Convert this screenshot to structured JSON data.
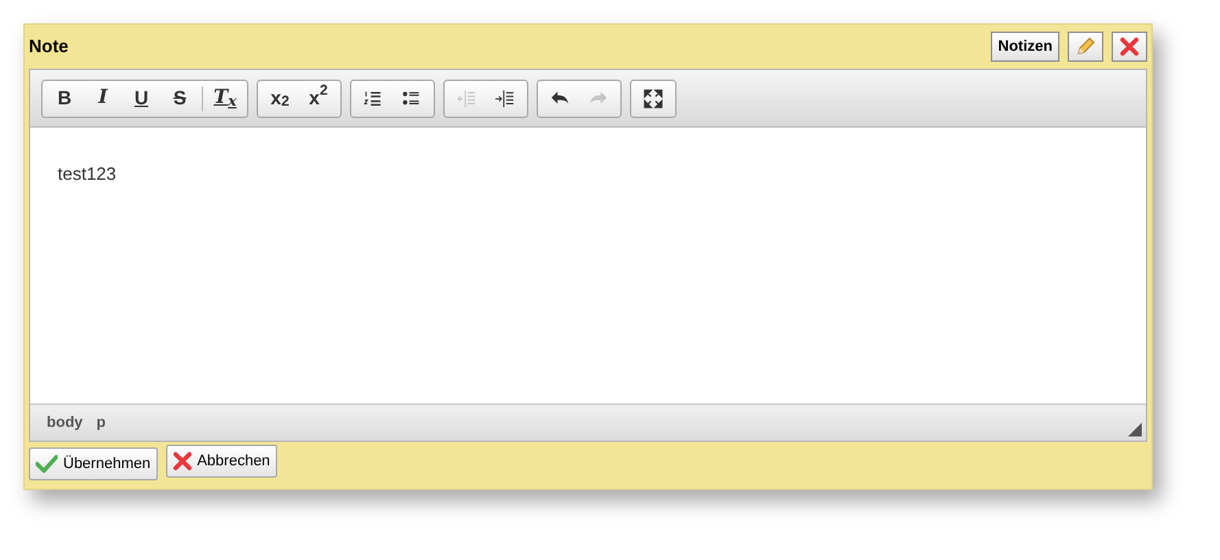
{
  "panel": {
    "title": "Note",
    "header_buttons": [
      {
        "kind": "text",
        "label": "Notizen"
      },
      {
        "kind": "edit"
      },
      {
        "kind": "close"
      }
    ]
  },
  "toolbar": {
    "groups": [
      {
        "items": [
          {
            "kind": "bold",
            "label": "B",
            "disabled": false
          },
          {
            "kind": "italic",
            "label": "I",
            "disabled": false
          },
          {
            "kind": "underline",
            "label": "U",
            "disabled": false
          },
          {
            "kind": "strike",
            "label": "S",
            "disabled": false
          },
          {
            "kind": "clear",
            "label": "T$_{x}$",
            "disabled": false
          }
        ]
      },
      {
        "items": [
          {
            "kind": "sub",
            "label": "x$_{2}$",
            "disabled": false
          },
          {
            "kind": "sup",
            "label": "x$^{2}$",
            "disabled": false
          }
        ]
      },
      {
        "items": [
          {
            "kind": "ol",
            "disabled": false
          },
          {
            "kind": "ul",
            "disabled": false
          }
        ]
      },
      {
        "items": [
          {
            "kind": "outdent",
            "disabled": true
          },
          {
            "kind": "indent",
            "disabled": false
          }
        ]
      },
      {
        "items": [
          {
            "kind": "undo",
            "disabled": false
          },
          {
            "kind": "redo",
            "disabled": true
          }
        ]
      },
      {
        "items": [
          {
            "kind": "maximize",
            "disabled": false
          }
        ]
      }
    ]
  },
  "content": "test123",
  "path": [
    "body",
    "p"
  ],
  "actions": [
    {
      "kind": "apply",
      "label": "Übernehmen"
    },
    {
      "kind": "cancel",
      "label": "Abbrechen"
    }
  ]
}
